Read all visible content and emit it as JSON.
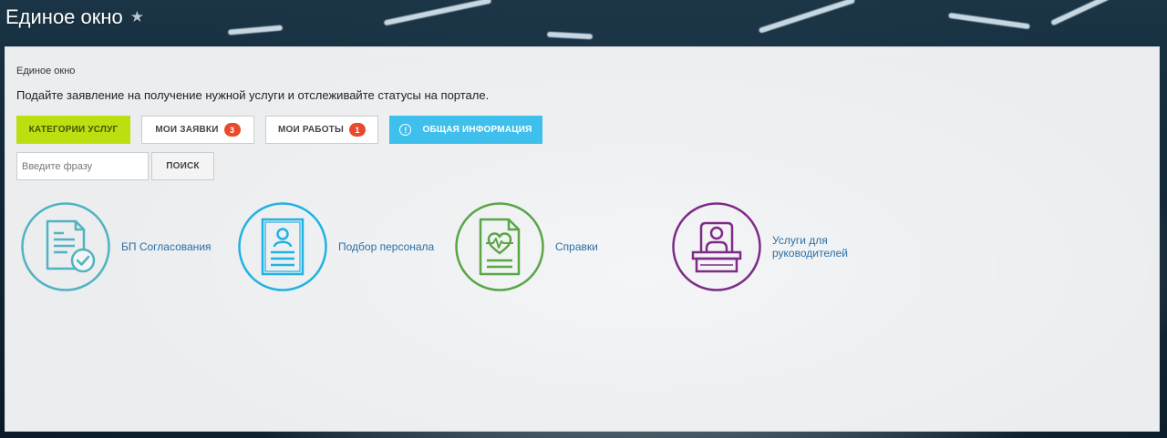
{
  "header": {
    "title": "Единое окно",
    "favorite_icon": "star-icon"
  },
  "breadcrumb": "Единое окно",
  "subtitle": "Подайте заявление на получение нужной услуги и отслеживайте статусы на портале.",
  "tabs": {
    "categories": "Категории услуг",
    "my_requests": {
      "label": "Мои заявки",
      "count": "3"
    },
    "my_works": {
      "label": "Мои работы",
      "count": "1"
    },
    "general_info": {
      "label": "Общая информация",
      "icon": "info-icon"
    }
  },
  "search": {
    "placeholder": "Введите фразу",
    "value": "",
    "button": "Поиск"
  },
  "services": [
    {
      "label": "БП Согласования",
      "icon": "document-check-icon",
      "color": "#4fb3c1"
    },
    {
      "label": "Подбор персонала",
      "icon": "resume-icon",
      "color": "#20b2e3"
    },
    {
      "label": "Справки",
      "icon": "medical-certificate-icon",
      "color": "#5aa546"
    },
    {
      "label": "Услуги для руководителей",
      "icon": "manager-podium-icon",
      "color": "#7e2b87"
    }
  ],
  "colors": {
    "accent_green": "#bbe00f",
    "accent_blue": "#3fc0ec",
    "badge_red": "#e84a2a",
    "link": "#2b6fa6"
  }
}
